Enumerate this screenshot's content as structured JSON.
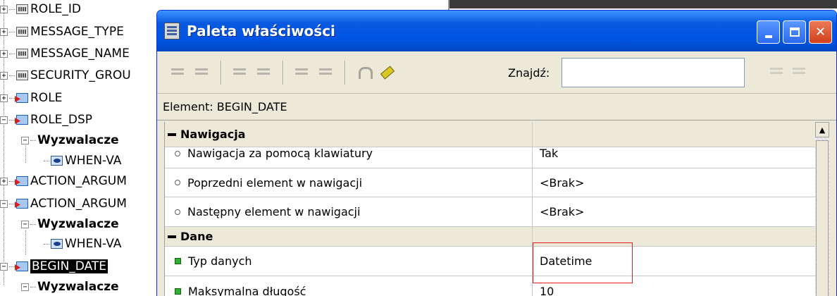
{
  "tree": {
    "items": [
      {
        "label": "ROLE_ID",
        "kind": "column",
        "expander": "+"
      },
      {
        "label": "MESSAGE_TYPE",
        "kind": "column",
        "expander": "+"
      },
      {
        "label": "MESSAGE_NAME",
        "kind": "column",
        "expander": "+"
      },
      {
        "label": "SECURITY_GROU",
        "kind": "column",
        "expander": "+"
      },
      {
        "label": "ROLE",
        "kind": "item",
        "expander": "+"
      },
      {
        "label": "ROLE_DSP",
        "kind": "item",
        "expander": "−"
      },
      {
        "label": "Wyzwalacze",
        "kind": "group",
        "expander": "−"
      },
      {
        "label": "WHEN-VA",
        "kind": "trigger"
      },
      {
        "label": "ACTION_ARGUM",
        "kind": "item",
        "expander": "+"
      },
      {
        "label": "ACTION_ARGUM",
        "kind": "item",
        "expander": "−"
      },
      {
        "label": "Wyzwalacze",
        "kind": "group",
        "expander": "−"
      },
      {
        "label": "WHEN-VA",
        "kind": "trigger"
      },
      {
        "label": "BEGIN_DATE",
        "kind": "item",
        "expander": "−",
        "selected": true
      },
      {
        "label": "Wyzwalacze",
        "kind": "group",
        "expander": "−"
      }
    ]
  },
  "window": {
    "title": "Paleta właściwości",
    "minimize_label": "",
    "maximize_label": "",
    "close_label": "✕"
  },
  "toolbar": {
    "find_label": "Znajdź:",
    "find_value": ""
  },
  "element_bar": {
    "label": "Element: BEGIN_DATE"
  },
  "properties": [
    {
      "type": "category",
      "name": "Nawigacja",
      "value": ""
    },
    {
      "type": "property",
      "bullet": "circle",
      "name": "Nawigacja za pomocą klawiatury",
      "value": "Tak"
    },
    {
      "type": "property",
      "bullet": "circle",
      "name": "Poprzedni element w nawigacji",
      "value": "<Brak>"
    },
    {
      "type": "property",
      "bullet": "circle",
      "name": "Następny element w nawigacji",
      "value": "<Brak>"
    },
    {
      "type": "category",
      "name": "Dane",
      "value": ""
    },
    {
      "type": "property",
      "bullet": "green",
      "name": "Typ danych",
      "value": "Datetime"
    },
    {
      "type": "property",
      "bullet": "green",
      "name": "Maksymalna długość",
      "value": "10"
    }
  ],
  "scrollbar": {
    "up_glyph": "▲"
  },
  "colors": {
    "titlebar": "#0054e3",
    "window_face": "#ece9d8",
    "highlight_box": "#e02020",
    "selection": "#000000"
  }
}
